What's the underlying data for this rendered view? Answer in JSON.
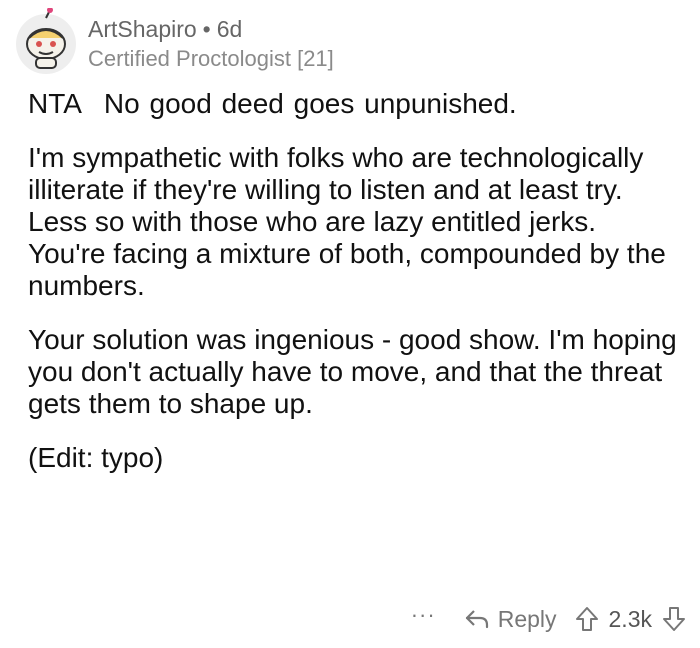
{
  "comment": {
    "author": {
      "username": "ArtShapiro",
      "separator": "•",
      "age": "6d",
      "flair": "Certified Proctologist [21]",
      "avatar_icon": "snoo-avatar-icon"
    },
    "body": {
      "verdict": "NTA",
      "headline": "No good deed goes unpunished.",
      "paragraphs": [
        "I'm sympathetic with folks who are technologically illiterate if they're willing to listen and at least try.  Less so with those who are lazy entitled jerks.  You're facing a mixture of both, compounded by the numbers.",
        "Your solution was ingenious - good show. I'm hoping you don't actually have to move, and that the threat gets them to shape up.",
        "(Edit: typo)"
      ]
    },
    "actions": {
      "more_label": "···",
      "reply_label": "Reply",
      "score": "2.3k",
      "upvote_icon": "upvote-arrow-icon",
      "downvote_icon": "downvote-arrow-icon",
      "reply_icon": "reply-arrow-icon"
    }
  },
  "colors": {
    "text": "#111111",
    "muted": "#777777",
    "background": "#ffffff"
  }
}
